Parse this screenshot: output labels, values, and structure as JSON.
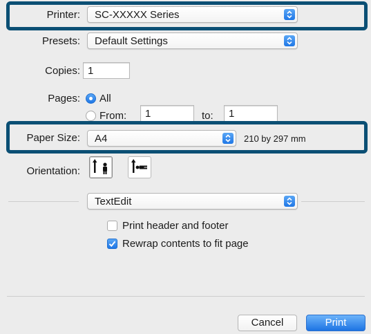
{
  "printer": {
    "label": "Printer:",
    "value": "SC-XXXXX Series"
  },
  "presets": {
    "label": "Presets:",
    "value": "Default Settings"
  },
  "copies": {
    "label": "Copies:",
    "value": "1"
  },
  "pages": {
    "label": "Pages:",
    "all_label": "All",
    "from_label": "From:",
    "from_value": "1",
    "to_label": "to:",
    "to_value": "1",
    "selected": "All"
  },
  "paper_size": {
    "label": "Paper Size:",
    "value": "A4",
    "dimensions": "210 by 297 mm"
  },
  "orientation": {
    "label": "Orientation:",
    "selected": "portrait"
  },
  "section_popup": {
    "value": "TextEdit"
  },
  "options": [
    {
      "label": "Print header and footer",
      "checked": false
    },
    {
      "label": "Rewrap contents to fit page",
      "checked": true
    }
  ],
  "buttons": {
    "cancel": "Cancel",
    "print": "Print"
  },
  "colors": {
    "highlight": "#0b4f74",
    "accent": "#1f77e6"
  }
}
